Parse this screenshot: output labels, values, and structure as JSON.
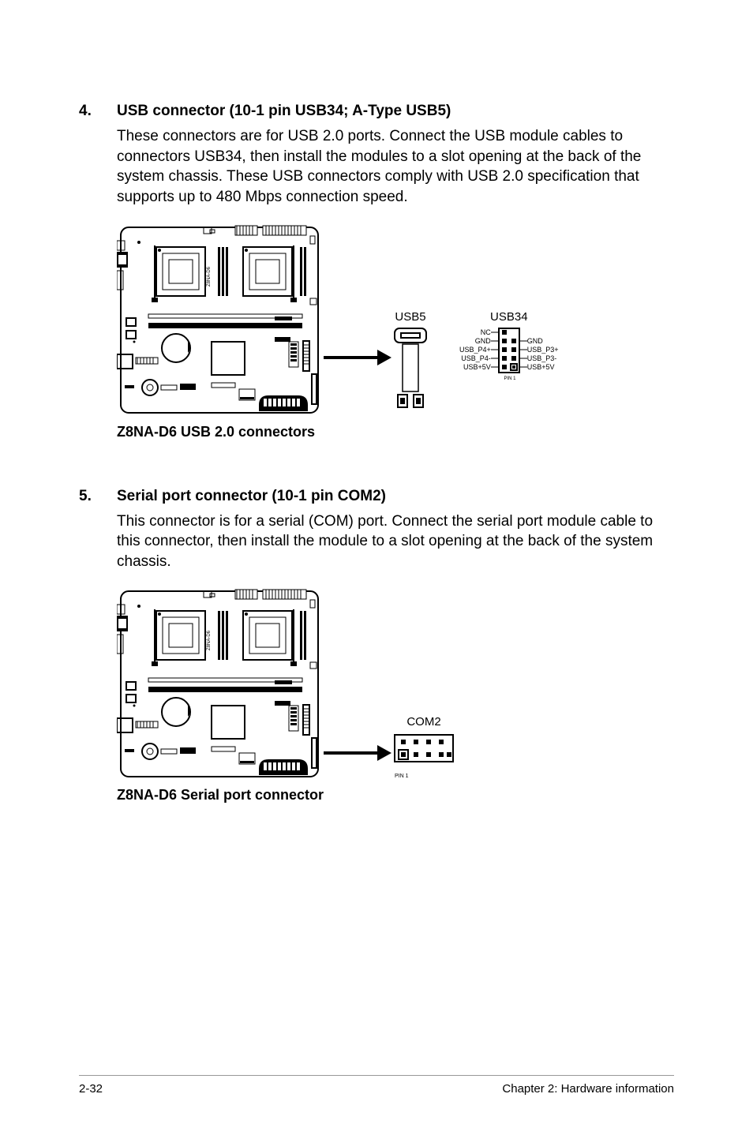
{
  "section4": {
    "num": "4.",
    "title": "USB connector (10-1 pin USB34; A-Type USB5)",
    "text": "These connectors are for USB 2.0 ports. Connect the USB module cables to connectors USB34, then install the modules to a slot opening at the back of the system chassis. These USB connectors comply with USB 2.0 specification that supports up to 480 Mbps connection speed."
  },
  "fig1": {
    "caption": "Z8NA-D6 USB 2.0 connectors",
    "usb5_label": "USB5",
    "usb34_label": "USB34",
    "pins_left": [
      "NC",
      "GND",
      "USB_P4+",
      "USB_P4-",
      "USB+5V"
    ],
    "pins_right": [
      "",
      "GND",
      "USB_P3+",
      "USB_P3-",
      "USB+5V"
    ],
    "pin1": "PIN 1"
  },
  "section5": {
    "num": "5.",
    "title": "Serial port connector (10-1 pin COM2)",
    "text": "This connector is for a serial (COM) port. Connect the serial port module cable to this connector, then install the module to a slot opening at the back of the system chassis."
  },
  "fig2": {
    "caption": "Z8NA-D6 Serial port connector",
    "com2_label": "COM2",
    "pin1": "PIN 1"
  },
  "footer": {
    "left": "2-32",
    "right": "Chapter 2: Hardware information"
  },
  "board": {
    "model_label": "Z8NA-D6"
  }
}
